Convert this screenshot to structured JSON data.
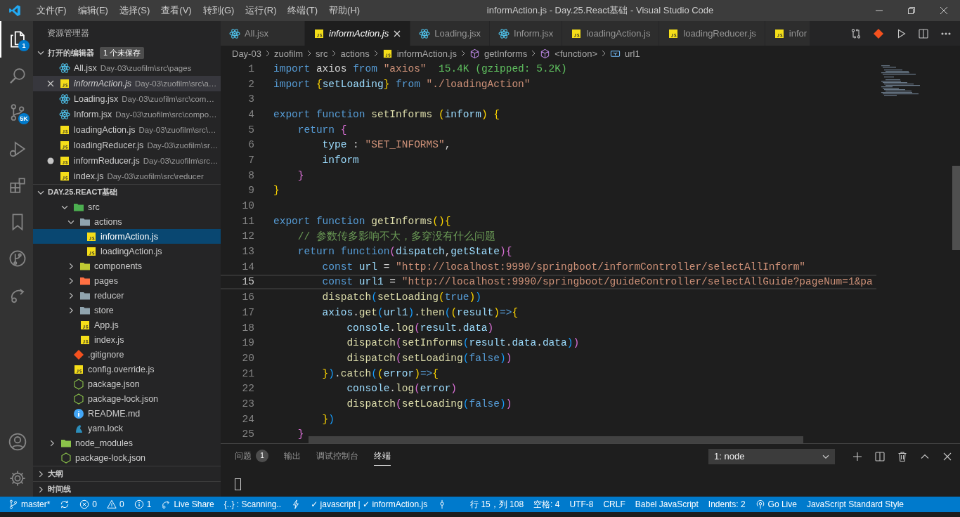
{
  "window": {
    "title": "informAction.js - Day.25.React基础 - Visual Studio Code"
  },
  "menu": [
    "文件(F)",
    "编辑(E)",
    "选择(S)",
    "查看(V)",
    "转到(G)",
    "运行(R)",
    "终端(T)",
    "帮助(H)"
  ],
  "activity_bar": {
    "top": [
      {
        "selected": true,
        "badge": "1"
      },
      {
        "selected": false
      },
      {
        "selected": false,
        "badge": "5K"
      },
      {
        "selected": false
      },
      {
        "selected": false
      },
      {
        "selected": false
      },
      {
        "selected": false
      },
      {
        "selected": false
      }
    ],
    "bottom": [
      {
        "selected": false
      },
      {
        "selected": false
      }
    ]
  },
  "sidebar": {
    "title": "资源管理器",
    "open_editors": {
      "title": "打开的编辑器",
      "badge": "1 个未保存",
      "expanded": true,
      "items": [
        {
          "name": "All.jsx",
          "path": "Day-03\\zuofilm\\src\\pages",
          "kind": "react",
          "selected": false,
          "preview": false,
          "dirty": false
        },
        {
          "name": "informAction.js",
          "path": "Day-03\\zuofilm\\src\\a…",
          "kind": "js",
          "selected": true,
          "preview": true,
          "dirty": false
        },
        {
          "name": "Loading.jsx",
          "path": "Day-03\\zuofilm\\src\\com…",
          "kind": "react",
          "selected": false,
          "preview": false,
          "dirty": false
        },
        {
          "name": "Inform.jsx",
          "path": "Day-03\\zuofilm\\src\\compo…",
          "kind": "react",
          "selected": false,
          "preview": false,
          "dirty": false
        },
        {
          "name": "loadingAction.js",
          "path": "Day-03\\zuofilm\\src\\…",
          "kind": "js",
          "selected": false,
          "preview": false,
          "dirty": false
        },
        {
          "name": "loadingReducer.js",
          "path": "Day-03\\zuofilm\\sr…",
          "kind": "js",
          "selected": false,
          "preview": false,
          "dirty": false
        },
        {
          "name": "informReducer.js",
          "path": "Day-03\\zuofilm\\src…",
          "kind": "js",
          "selected": false,
          "preview": false,
          "dirty": true
        },
        {
          "name": "index.js",
          "path": "Day-03\\zuofilm\\src\\reducer",
          "kind": "js",
          "selected": false,
          "preview": false,
          "dirty": false
        }
      ]
    },
    "folder": {
      "title": "DAY.25.REACT基础",
      "expanded": true,
      "tree": [
        {
          "kind": "group",
          "children": [
            {
              "kind": "folder-src",
              "name": "src",
              "expanded": true,
              "selected": false,
              "children": [
                {
                  "kind": "folder-open",
                  "name": "actions",
                  "expanded": true,
                  "selected": false,
                  "children": [
                    {
                      "kind": "js",
                      "name": "informAction.js",
                      "selected": true
                    },
                    {
                      "kind": "js",
                      "name": "loadingAction.js",
                      "selected": false
                    }
                  ]
                },
                {
                  "kind": "folder-components",
                  "name": "components",
                  "expanded": false,
                  "selected": false
                },
                {
                  "kind": "folder-pages",
                  "name": "pages",
                  "expanded": false,
                  "selected": false
                },
                {
                  "kind": "folder",
                  "name": "reducer",
                  "expanded": false,
                  "selected": false
                },
                {
                  "kind": "folder",
                  "name": "store",
                  "expanded": false,
                  "selected": false
                },
                {
                  "kind": "js",
                  "name": "App.js",
                  "selected": false
                },
                {
                  "kind": "js",
                  "name": "index.js",
                  "selected": false
                }
              ]
            },
            {
              "kind": "git",
              "name": ".gitignore",
              "selected": false
            },
            {
              "kind": "js",
              "name": "config.override.js",
              "selected": false
            },
            {
              "kind": "node",
              "name": "package.json",
              "selected": false
            },
            {
              "kind": "node",
              "name": "package-lock.json",
              "selected": false
            },
            {
              "kind": "info",
              "name": "README.md",
              "selected": false
            },
            {
              "kind": "yarn",
              "name": "yarn.lock",
              "selected": false
            }
          ]
        },
        {
          "kind": "folder-node",
          "name": "node_modules",
          "expanded": false,
          "selected": false
        },
        {
          "kind": "node",
          "name": "package-lock.json",
          "selected": false
        }
      ]
    },
    "sections": [
      {
        "title": "大纲",
        "expanded": false
      },
      {
        "title": "时间线",
        "expanded": false
      }
    ]
  },
  "tabs": [
    {
      "label": "All.jsx",
      "kind": "react",
      "selected": false,
      "preview": false
    },
    {
      "label": "informAction.js",
      "kind": "js",
      "selected": true,
      "preview": true
    },
    {
      "label": "Loading.jsx",
      "kind": "react",
      "selected": false,
      "preview": false
    },
    {
      "label": "Inform.jsx",
      "kind": "react",
      "selected": false,
      "preview": false
    },
    {
      "label": "loadingAction.js",
      "kind": "js",
      "selected": false,
      "preview": false
    },
    {
      "label": "loadingReducer.js",
      "kind": "js",
      "selected": false,
      "preview": false
    },
    {
      "label": "infor",
      "kind": "js",
      "selected": false,
      "preview": false
    }
  ],
  "breadcrumb": [
    {
      "label": "Day-03"
    },
    {
      "label": "zuofilm"
    },
    {
      "label": "src"
    },
    {
      "label": "actions"
    },
    {
      "label": "informAction.js",
      "kind": "js"
    },
    {
      "label": "getInforms",
      "kind": "cube"
    },
    {
      "label": "<function>",
      "kind": "cube"
    },
    {
      "label": "url1",
      "kind": "variable"
    }
  ],
  "code": [
    {
      "number": "1",
      "current": false,
      "tokens": [
        {
          "kind": "kw",
          "text": "import"
        },
        {
          "kind": "plain",
          "text": " axios "
        },
        {
          "kind": "kw",
          "text": "from"
        },
        {
          "kind": "str",
          "text": " \"axios\""
        },
        {
          "kind": "cost",
          "text": "  15.4K (gzipped: 5.2K)"
        }
      ]
    },
    {
      "number": "2",
      "current": false,
      "tokens": [
        {
          "kind": "kw",
          "text": "import"
        },
        {
          "kind": "b1",
          "text": " {"
        },
        {
          "kind": "var",
          "text": "setLoading"
        },
        {
          "kind": "b1",
          "text": "}"
        },
        {
          "kind": "kw",
          "text": " from"
        },
        {
          "kind": "str",
          "text": " \"./loadingAction\""
        }
      ]
    },
    {
      "number": "3",
      "current": false
    },
    {
      "number": "4",
      "current": false,
      "tokens": [
        {
          "kind": "kw",
          "text": "export function"
        },
        {
          "kind": "fn",
          "text": " setInforms"
        },
        {
          "kind": "b1",
          "text": " ("
        },
        {
          "kind": "var",
          "text": "inform"
        },
        {
          "kind": "b1",
          "text": ") {"
        }
      ]
    },
    {
      "number": "5",
      "current": false,
      "tokens": [
        {
          "kind": "kw",
          "text": "    return"
        },
        {
          "kind": "b2",
          "text": " {"
        }
      ]
    },
    {
      "number": "6",
      "current": false,
      "tokens": [
        {
          "kind": "var",
          "text": "        type"
        },
        {
          "kind": "plain",
          "text": " : "
        },
        {
          "kind": "str",
          "text": "\"SET_INFORMS\""
        },
        {
          "kind": "plain",
          "text": ","
        }
      ]
    },
    {
      "number": "7",
      "current": false,
      "tokens": [
        {
          "kind": "var",
          "text": "        inform"
        }
      ]
    },
    {
      "number": "8",
      "current": false,
      "tokens": [
        {
          "kind": "b2",
          "text": "    }"
        }
      ]
    },
    {
      "number": "9",
      "current": false,
      "tokens": [
        {
          "kind": "b1",
          "text": "}"
        }
      ]
    },
    {
      "number": "10",
      "current": false
    },
    {
      "number": "11",
      "current": false,
      "tokens": [
        {
          "kind": "kw",
          "text": "export function"
        },
        {
          "kind": "fn",
          "text": " getInforms"
        },
        {
          "kind": "b1",
          "text": "(){"
        }
      ]
    },
    {
      "number": "12",
      "current": false,
      "tokens": [
        {
          "kind": "cmt",
          "text": "    // 参数传多影响不大，多穿没有什么问题"
        }
      ]
    },
    {
      "number": "13",
      "current": false,
      "tokens": [
        {
          "kind": "kw",
          "text": "    return function"
        },
        {
          "kind": "b2",
          "text": "("
        },
        {
          "kind": "var",
          "text": "dispatch"
        },
        {
          "kind": "plain",
          "text": ","
        },
        {
          "kind": "var",
          "text": "getState"
        },
        {
          "kind": "b2",
          "text": "){"
        }
      ]
    },
    {
      "number": "14",
      "current": false,
      "tokens": [
        {
          "kind": "kw",
          "text": "        const"
        },
        {
          "kind": "var",
          "text": " url"
        },
        {
          "kind": "plain",
          "text": " = "
        },
        {
          "kind": "str",
          "text": "\"http://localhost:9990/springboot/informController/selectAllInform\""
        }
      ]
    },
    {
      "number": "15",
      "current": true,
      "tokens": [
        {
          "kind": "kw",
          "text": "        const"
        },
        {
          "kind": "var",
          "text": " url1"
        },
        {
          "kind": "plain",
          "text": " = "
        },
        {
          "kind": "str",
          "text": "\"http://localhost:9990/springboot/guideController/selectAllGuide?pageNum=1&pa"
        }
      ]
    },
    {
      "number": "16",
      "current": false,
      "tokens": [
        {
          "kind": "fn",
          "text": "        dispatch"
        },
        {
          "kind": "b3",
          "text": "("
        },
        {
          "kind": "fn",
          "text": "setLoading"
        },
        {
          "kind": "b1",
          "text": "("
        },
        {
          "kind": "kw",
          "text": "true"
        },
        {
          "kind": "b1",
          "text": ")"
        },
        {
          "kind": "b3",
          "text": ")"
        }
      ]
    },
    {
      "number": "17",
      "current": false,
      "tokens": [
        {
          "kind": "var",
          "text": "        axios"
        },
        {
          "kind": "plain",
          "text": "."
        },
        {
          "kind": "fn",
          "text": "get"
        },
        {
          "kind": "b3",
          "text": "("
        },
        {
          "kind": "var",
          "text": "url1"
        },
        {
          "kind": "b3",
          "text": ")"
        },
        {
          "kind": "plain",
          "text": "."
        },
        {
          "kind": "fn",
          "text": "then"
        },
        {
          "kind": "b3",
          "text": "("
        },
        {
          "kind": "b1",
          "text": "("
        },
        {
          "kind": "var",
          "text": "result"
        },
        {
          "kind": "b1",
          "text": ")"
        },
        {
          "kind": "kw",
          "text": "=>"
        },
        {
          "kind": "b1",
          "text": "{"
        }
      ]
    },
    {
      "number": "18",
      "current": false,
      "tokens": [
        {
          "kind": "var",
          "text": "            console"
        },
        {
          "kind": "plain",
          "text": "."
        },
        {
          "kind": "fn",
          "text": "log"
        },
        {
          "kind": "b2",
          "text": "("
        },
        {
          "kind": "var",
          "text": "result"
        },
        {
          "kind": "plain",
          "text": "."
        },
        {
          "kind": "var",
          "text": "data"
        },
        {
          "kind": "b2",
          "text": ")"
        }
      ]
    },
    {
      "number": "19",
      "current": false,
      "tokens": [
        {
          "kind": "fn",
          "text": "            dispatch"
        },
        {
          "kind": "b2",
          "text": "("
        },
        {
          "kind": "fn",
          "text": "setInforms"
        },
        {
          "kind": "b3",
          "text": "("
        },
        {
          "kind": "var",
          "text": "result"
        },
        {
          "kind": "plain",
          "text": "."
        },
        {
          "kind": "var",
          "text": "data"
        },
        {
          "kind": "plain",
          "text": "."
        },
        {
          "kind": "var",
          "text": "data"
        },
        {
          "kind": "b3",
          "text": ")"
        },
        {
          "kind": "b2",
          "text": ")"
        }
      ]
    },
    {
      "number": "20",
      "current": false,
      "tokens": [
        {
          "kind": "fn",
          "text": "            dispatch"
        },
        {
          "kind": "b2",
          "text": "("
        },
        {
          "kind": "fn",
          "text": "setLoading"
        },
        {
          "kind": "b3",
          "text": "("
        },
        {
          "kind": "kw",
          "text": "false"
        },
        {
          "kind": "b3",
          "text": ")"
        },
        {
          "kind": "b2",
          "text": ")"
        }
      ]
    },
    {
      "number": "21",
      "current": false,
      "tokens": [
        {
          "kind": "b1",
          "text": "        }"
        },
        {
          "kind": "b3",
          "text": ")"
        },
        {
          "kind": "plain",
          "text": "."
        },
        {
          "kind": "fn",
          "text": "catch"
        },
        {
          "kind": "b3",
          "text": "("
        },
        {
          "kind": "b1",
          "text": "("
        },
        {
          "kind": "var",
          "text": "error"
        },
        {
          "kind": "b1",
          "text": ")"
        },
        {
          "kind": "kw",
          "text": "=>"
        },
        {
          "kind": "b1",
          "text": "{"
        }
      ]
    },
    {
      "number": "22",
      "current": false,
      "tokens": [
        {
          "kind": "var",
          "text": "            console"
        },
        {
          "kind": "plain",
          "text": "."
        },
        {
          "kind": "fn",
          "text": "log"
        },
        {
          "kind": "b2",
          "text": "("
        },
        {
          "kind": "var",
          "text": "error"
        },
        {
          "kind": "b2",
          "text": ")"
        }
      ]
    },
    {
      "number": "23",
      "current": false,
      "tokens": [
        {
          "kind": "fn",
          "text": "            dispatch"
        },
        {
          "kind": "b2",
          "text": "("
        },
        {
          "kind": "fn",
          "text": "setLoading"
        },
        {
          "kind": "b3",
          "text": "("
        },
        {
          "kind": "kw",
          "text": "false"
        },
        {
          "kind": "b3",
          "text": ")"
        },
        {
          "kind": "b2",
          "text": ")"
        }
      ]
    },
    {
      "number": "24",
      "current": false,
      "tokens": [
        {
          "kind": "b1",
          "text": "        }"
        },
        {
          "kind": "b3",
          "text": ")"
        }
      ]
    },
    {
      "number": "25",
      "current": false,
      "tokens": [
        {
          "kind": "b2",
          "text": "    }"
        }
      ]
    }
  ],
  "panel": {
    "tabs": [
      {
        "label": "问题",
        "badge": "1",
        "selected": false
      },
      {
        "label": "输出",
        "selected": false
      },
      {
        "label": "调试控制台",
        "selected": false
      },
      {
        "label": "终端",
        "selected": true
      }
    ],
    "terminal_select": {
      "value": "1: node"
    }
  },
  "status_bar": {
    "left": [
      {
        "kind": "branch",
        "text": "master*"
      },
      {
        "kind": "sync"
      },
      {
        "kind": "error",
        "text": "0"
      },
      {
        "kind": "warning",
        "text": "0"
      },
      {
        "kind": "info",
        "text": "1"
      },
      {
        "kind": "live-share",
        "text": "Live Share"
      },
      {
        "kind": "plain",
        "text": "{..} : Scanning.."
      },
      {
        "kind": "bolt"
      },
      {
        "kind": "plain",
        "text": "✓ javascript | ✓ informAction.js"
      },
      {
        "kind": "pin"
      }
    ],
    "right": [
      {
        "kind": "plain",
        "text": "行 15，列 108"
      },
      {
        "kind": "plain",
        "text": "空格: 4"
      },
      {
        "kind": "plain",
        "text": "UTF-8"
      },
      {
        "kind": "plain",
        "text": "CRLF"
      },
      {
        "kind": "plain",
        "text": "Babel JavaScript"
      },
      {
        "kind": "plain",
        "text": "Indents: 2"
      },
      {
        "kind": "broadcast",
        "text": "Go Live"
      },
      {
        "kind": "plain",
        "text": "JavaScript Standard Style"
      }
    ]
  }
}
